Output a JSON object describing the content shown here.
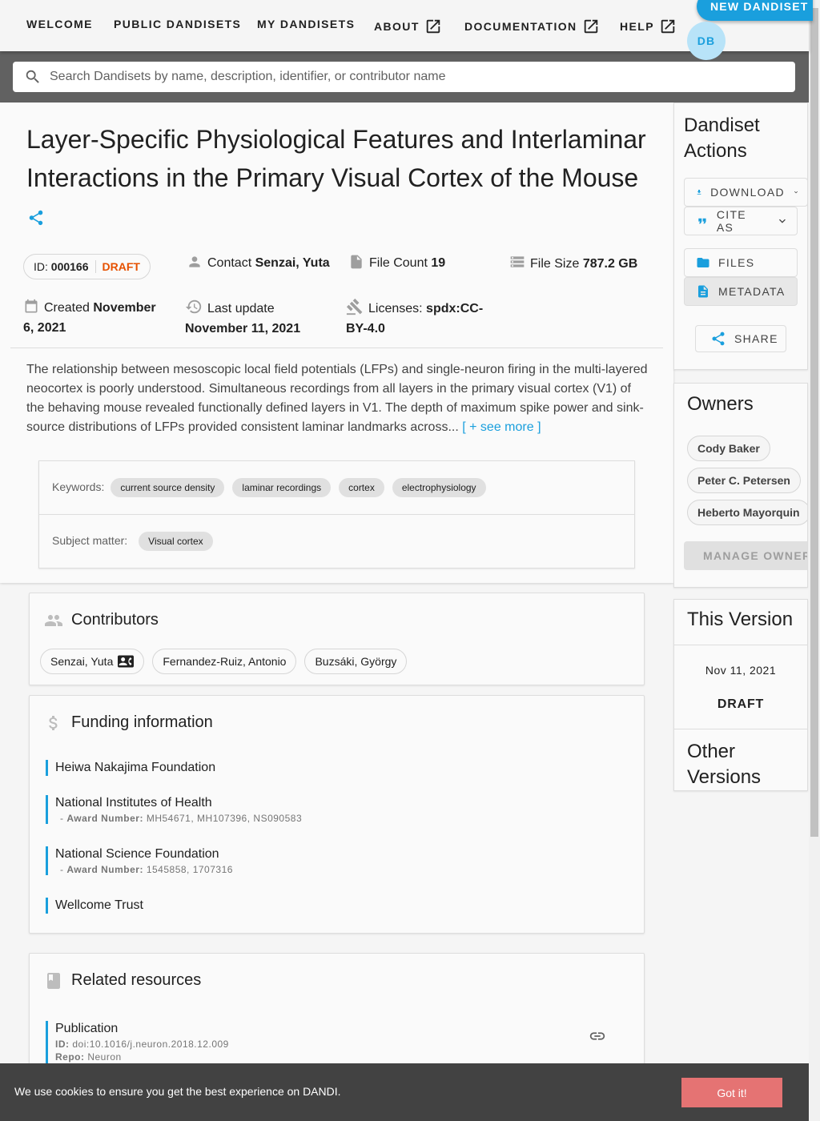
{
  "nav": {
    "items": [
      "WELCOME",
      "PUBLIC DANDISETS",
      "MY DANDISETS",
      "ABOUT",
      "DOCUMENTATION",
      "HELP"
    ],
    "new_dandiset": "NEW DANDISET",
    "avatar_initials": "DB"
  },
  "search": {
    "placeholder": "Search Dandisets by name, description, identifier, or contributor name"
  },
  "dandiset": {
    "title": "Layer-Specific Physiological Features and Interlaminar Interactions in the Primary Visual Cortex of the Mouse",
    "id_label": "ID:",
    "id": "000166",
    "status": "DRAFT",
    "contact_label": "Contact",
    "contact": "Senzai, Yuta",
    "file_count_label": "File Count",
    "file_count": "19",
    "file_size_label": "File Size",
    "file_size": "787.2 GB",
    "created_label": "Created",
    "created": "November 6, 2021",
    "updated_label": "Last update",
    "updated": "November 11, 2021",
    "licenses_label": "Licenses:",
    "licenses": "spdx:CC-BY-4.0",
    "description": "The relationship between mesoscopic local field potentials (LFPs) and single-neuron firing in the multi-layered neocortex is poorly understood. Simultaneous recordings from all layers in the primary visual cortex (V1) of the behaving mouse revealed functionally defined layers in V1. The depth of maximum spike power and sink-source distributions of LFPs provided consistent laminar landmarks across...",
    "see_more": "[ + see more ]",
    "keywords_label": "Keywords:",
    "keywords": [
      "current source density",
      "laminar recordings",
      "cortex",
      "electrophysiology"
    ],
    "subject_label": "Subject matter:",
    "subjects": [
      "Visual cortex"
    ]
  },
  "contributors": {
    "title": "Contributors",
    "people": [
      "Senzai, Yuta",
      "Fernandez-Ruiz, Antonio",
      "Buzsáki, György"
    ]
  },
  "funding": {
    "title": "Funding information",
    "award_label": "Award Number:",
    "items": [
      {
        "name": "Heiwa Nakajima Foundation",
        "award": ""
      },
      {
        "name": "National Institutes of Health",
        "award": "MH54671, MH107396, NS090583"
      },
      {
        "name": "National Science Foundation",
        "award": "1545858, 1707316"
      },
      {
        "name": "Wellcome Trust",
        "award": ""
      }
    ]
  },
  "related": {
    "title": "Related resources",
    "items": [
      {
        "type": "Publication",
        "id_label": "ID:",
        "id": "doi:10.1016/j.neuron.2018.12.009",
        "repo_label": "Repo:",
        "repo": "Neuron"
      }
    ]
  },
  "actions": {
    "title": "Dandiset Actions",
    "download": "DOWNLOAD",
    "cite": "CITE AS",
    "files": "FILES",
    "metadata": "METADATA",
    "share": "SHARE"
  },
  "owners": {
    "title": "Owners",
    "list": [
      "Cody Baker",
      "Peter C. Petersen",
      "Heberto Mayorquin"
    ],
    "manage": "MANAGE OWNERS"
  },
  "version": {
    "title": "This Version",
    "date": "Nov 11, 2021",
    "label": "DRAFT",
    "other_title": "Other Versions"
  },
  "cookie": {
    "message": "We use cookies to ensure you get the best experience on DANDI.",
    "button": "Got it!"
  },
  "colors": {
    "accent": "#1a9fdd",
    "draft": "#e65100",
    "cookie_button": "#e57373"
  }
}
